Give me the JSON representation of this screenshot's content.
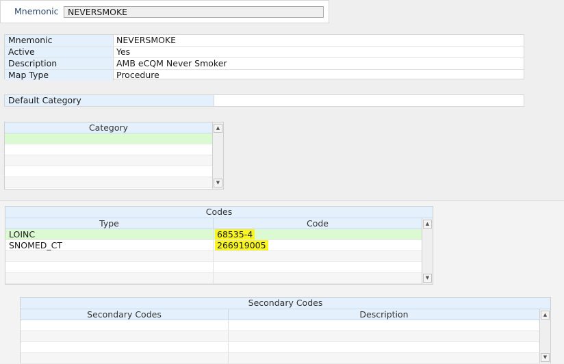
{
  "search": {
    "label": "Mnemonic",
    "value": "NEVERSMOKE"
  },
  "details": {
    "rows": [
      {
        "key": "Mnemonic",
        "value": "NEVERSMOKE"
      },
      {
        "key": "Active",
        "value": "Yes"
      },
      {
        "key": "Description",
        "value": "AMB eCQM Never Smoker"
      },
      {
        "key": "Map Type",
        "value": "Procedure"
      }
    ]
  },
  "default_category": {
    "key": "Default Category",
    "value": ""
  },
  "category_grid": {
    "header": "Category"
  },
  "codes_grid": {
    "title": "Codes",
    "columns": [
      "Type",
      "Code"
    ],
    "rows": [
      {
        "type": "LOINC",
        "code": "68535-4"
      },
      {
        "type": "SNOMED_CT",
        "code": "266919005"
      }
    ]
  },
  "secondary_grid": {
    "title": "Secondary Codes",
    "columns": [
      "Secondary Codes",
      "Description"
    ]
  },
  "icons": {
    "scroll_up": "arrow-up-icon",
    "scroll_down": "arrow-down-icon"
  },
  "colors": {
    "selected_row": "#dcfad2",
    "header_bg": "#e4f0fb",
    "highlight": "#f8f523"
  }
}
